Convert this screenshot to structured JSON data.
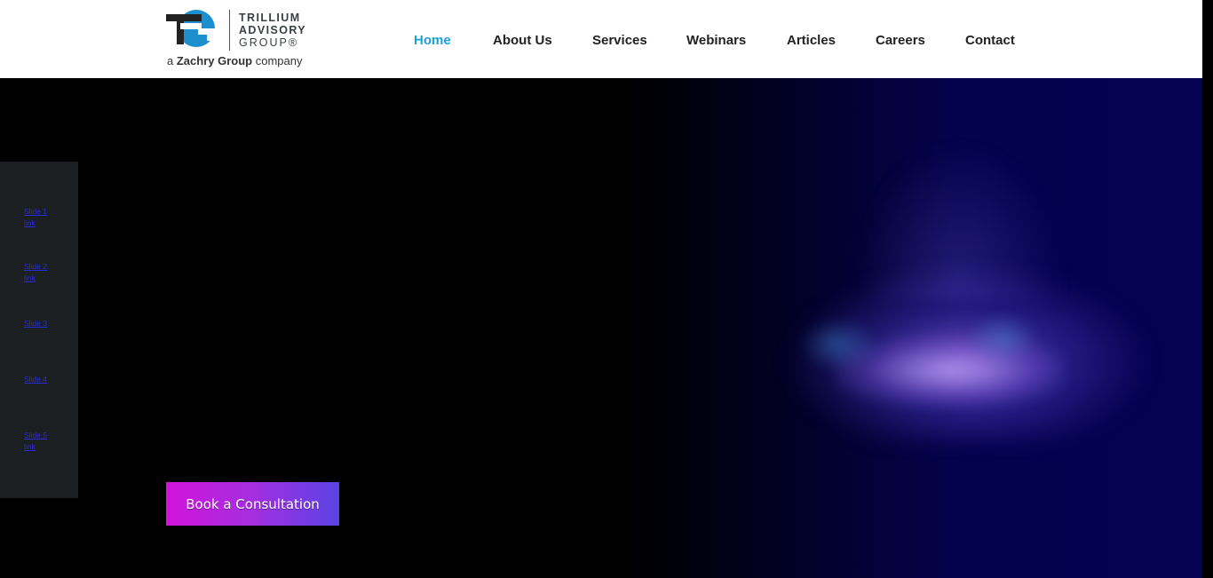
{
  "logo": {
    "line1": "TRILLIUM",
    "line2": "ADVISORY",
    "line3": "GROUP®",
    "tag_prefix": "a",
    "tag_brand": "Zachry Group",
    "tag_suffix": "company"
  },
  "nav": {
    "items": [
      {
        "label": "Home",
        "active": true
      },
      {
        "label": "About Us"
      },
      {
        "label": "Services"
      },
      {
        "label": "Webinars"
      },
      {
        "label": "Articles"
      },
      {
        "label": "Careers"
      },
      {
        "label": "Contact"
      }
    ]
  },
  "sidebar": {
    "links": [
      {
        "label": "Slide 1 link"
      },
      {
        "label": "Slide 2 link"
      },
      {
        "label": "Slide 3"
      },
      {
        "label": "Slide 4"
      },
      {
        "label": "Slide 5 link"
      }
    ]
  },
  "hero": {
    "cta_label": "Book a Consultation"
  },
  "colors": {
    "nav_active": "#1ba0d8",
    "nav_text": "#222222",
    "cta_gradient_start": "#d313de",
    "cta_gradient_end": "#5a43e4",
    "sidebar_bg": "#1c1f21",
    "hero_right": "#050252"
  }
}
